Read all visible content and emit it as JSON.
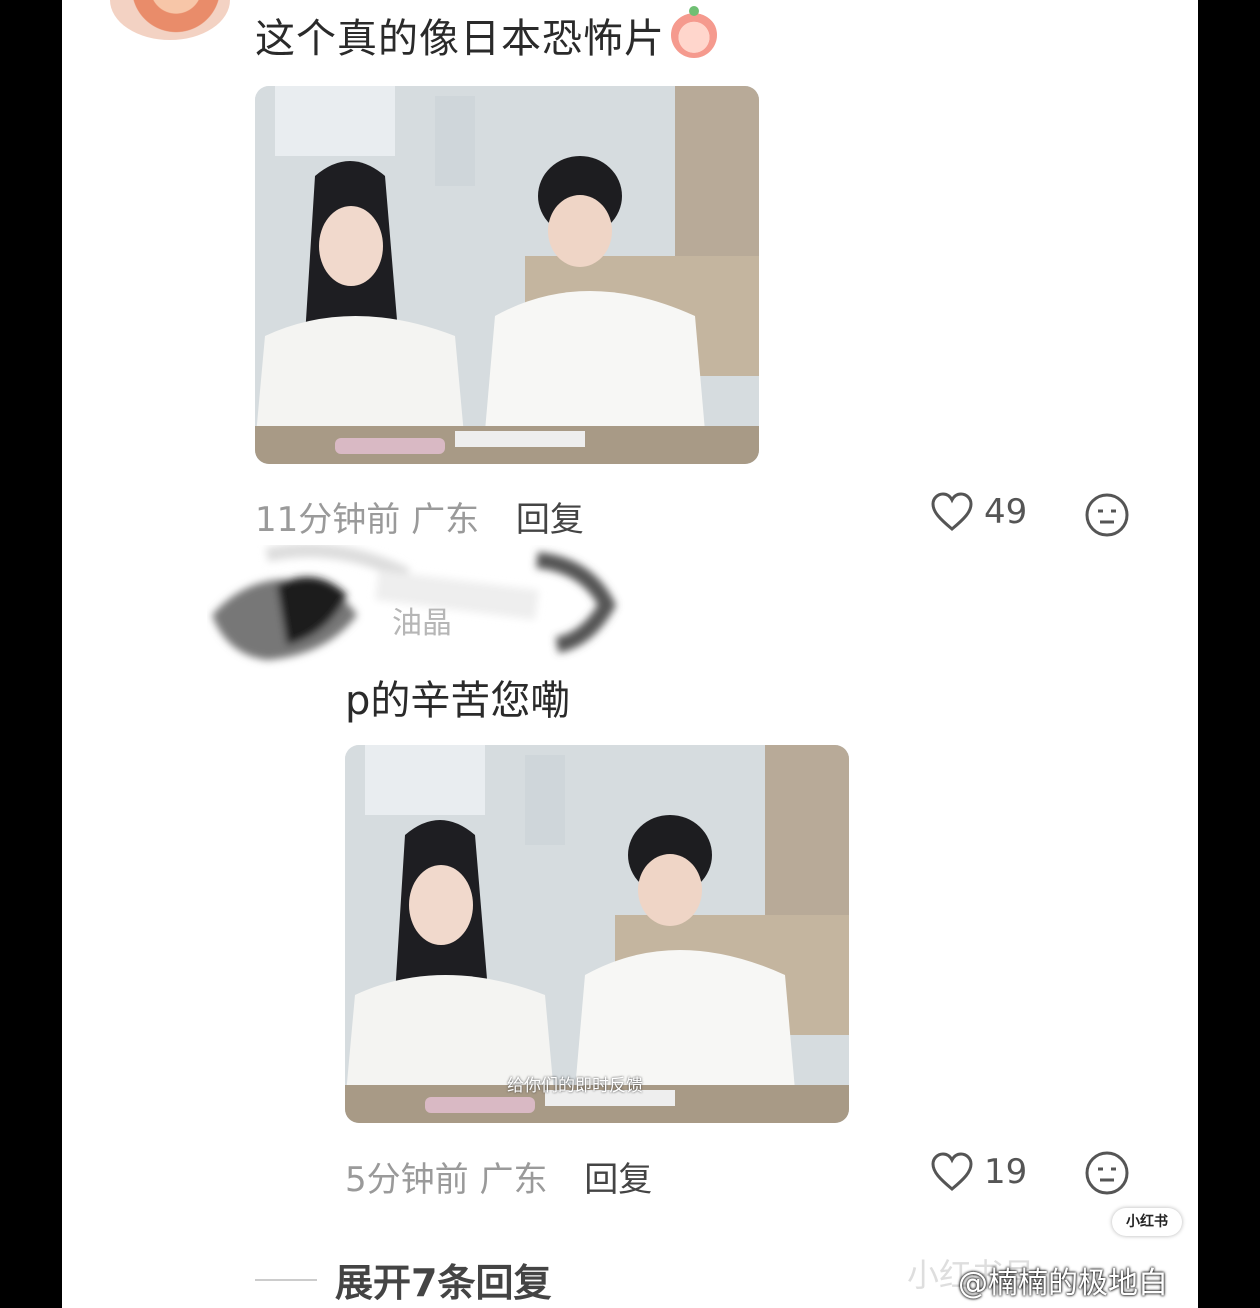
{
  "comment1": {
    "text": "这个真的像日本恐怖片",
    "emoji_icon": "crying-face-emoji",
    "time": "11分钟前",
    "location": "广东",
    "reply_label": "回复",
    "likes": "49"
  },
  "reply1": {
    "author_name": "油晶",
    "text": "p的辛苦您嘞",
    "video_caption": "给你们的即时反馈",
    "time": "5分钟前",
    "location": "广东",
    "reply_label": "回复",
    "likes": "19"
  },
  "expand_label": "展开7条回复",
  "watermark": {
    "badge": "小红书",
    "faint": "小红书号",
    "text": "@楠楠的极地白"
  }
}
